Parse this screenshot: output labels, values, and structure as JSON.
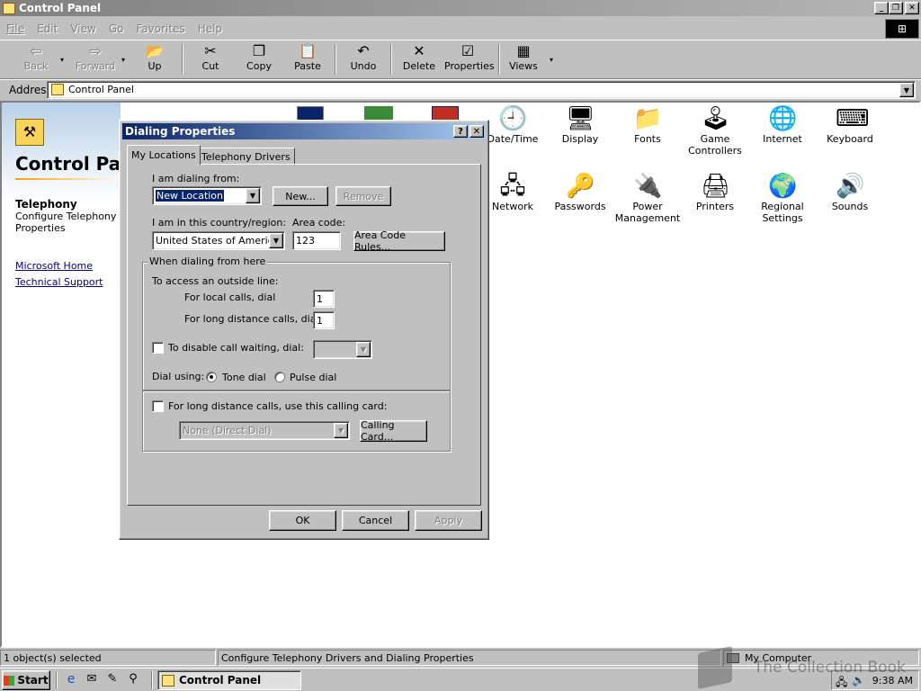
{
  "window": {
    "title": "Control Panel"
  },
  "menu": [
    "File",
    "Edit",
    "View",
    "Go",
    "Favorites",
    "Help"
  ],
  "toolbar": {
    "back": "Back",
    "forward": "Forward",
    "up": "Up",
    "cut": "Cut",
    "copy": "Copy",
    "paste": "Paste",
    "undo": "Undo",
    "delete": "Delete",
    "properties": "Properties",
    "views": "Views"
  },
  "address": {
    "label": "Address",
    "value": "Control Panel"
  },
  "left_panel": {
    "title": "Control Pa",
    "item_title": "Telephony",
    "item_desc": "Configure Telephony Properties",
    "link_home": "Microsoft Home",
    "link_support": "Technical Support"
  },
  "icons": [
    {
      "label": "Date/Time",
      "icon": "calendar-clock-icon"
    },
    {
      "label": "Display",
      "icon": "monitor-icon"
    },
    {
      "label": "Fonts",
      "icon": "fonts-folder-icon"
    },
    {
      "label": "Game Controllers",
      "icon": "joystick-icon"
    },
    {
      "label": "Internet",
      "icon": "internet-globe-icon"
    },
    {
      "label": "Keyboard",
      "icon": "keyboard-icon"
    },
    {
      "label": "Network",
      "icon": "network-icon"
    },
    {
      "label": "Passwords",
      "icon": "keys-icon"
    },
    {
      "label": "Power Management",
      "icon": "power-icon"
    },
    {
      "label": "Printers",
      "icon": "printer-folder-icon"
    },
    {
      "label": "Regional Settings",
      "icon": "globe-icon"
    },
    {
      "label": "Sounds",
      "icon": "speaker-icon"
    }
  ],
  "dialog": {
    "title": "Dialing Properties",
    "tabs": [
      "My Locations",
      "Telephony Drivers"
    ],
    "dialing_from_label": "I am dialing from:",
    "location_value": "New Location",
    "new_button": "New...",
    "remove_button": "Remove",
    "country_label": "I am in this country/region:",
    "country_value": "United States of America",
    "area_code_label": "Area code:",
    "area_code_value": "123",
    "area_code_rules_button": "Area Code Rules...",
    "group_label": "When dialing from here",
    "outside_line_label": "To access an outside line:",
    "local_calls_label": "For local calls, dial",
    "local_calls_value": "1",
    "long_distance_label": "For long distance calls, dial",
    "long_distance_value": "1",
    "call_waiting_label": "To disable call waiting, dial:",
    "dial_using_label": "Dial using:",
    "tone_dial": "Tone dial",
    "pulse_dial": "Pulse dial",
    "calling_card_label": "For long distance calls, use this calling card:",
    "calling_card_value": "None (Direct Dial)",
    "calling_card_button": "Calling Card...",
    "ok": "OK",
    "cancel": "Cancel",
    "apply": "Apply"
  },
  "status": {
    "selected": "1 object(s) selected",
    "description": "Configure Telephony Drivers and Dialing Properties",
    "zone": "My Computer"
  },
  "taskbar": {
    "start": "Start",
    "task": "Control Panel",
    "clock": "9:38 AM"
  },
  "watermark": "The Collection Book"
}
